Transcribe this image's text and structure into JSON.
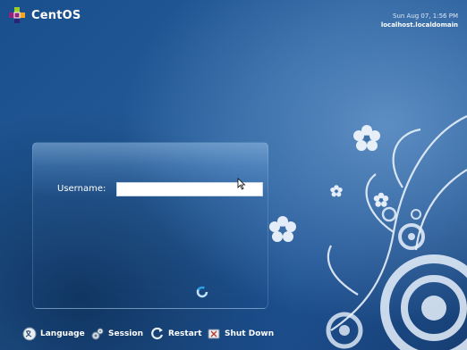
{
  "branding": {
    "name": "CentOS"
  },
  "clock": {
    "datetime": "Sun Aug 07,  1:56 PM",
    "hostname": "localhost.localdomain"
  },
  "login": {
    "username_label": "Username:",
    "username_value": ""
  },
  "bottom_bar": {
    "language": "Language",
    "session": "Session",
    "restart": "Restart",
    "shutdown": "Shut Down"
  },
  "colors": {
    "background": "#1f5592",
    "accent": "#ffffff"
  }
}
